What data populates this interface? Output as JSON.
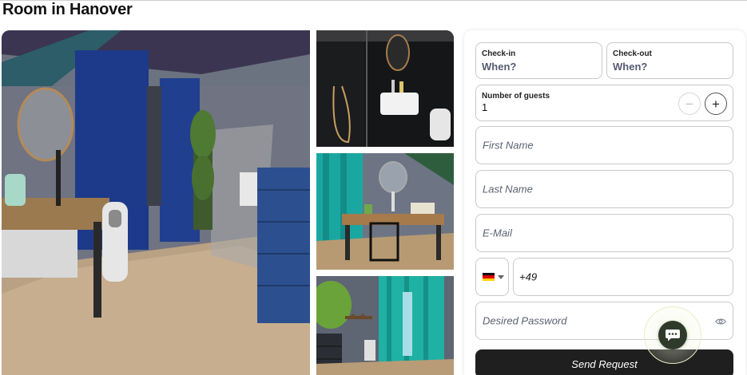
{
  "page": {
    "title": "Room in Hanover"
  },
  "gallery": {
    "photos": [
      {
        "subject": "bedroom-with-blue-curtains"
      },
      {
        "subject": "bathroom-shower-and-sink"
      },
      {
        "subject": "desk-with-teal-curtains"
      },
      {
        "subject": "room-with-teal-curtains-and-drawers"
      }
    ]
  },
  "form": {
    "checkin": {
      "label": "Check-in",
      "value": "When?"
    },
    "checkout": {
      "label": "Check-out",
      "value": "When?"
    },
    "guests": {
      "label": "Number of guests",
      "value": "1",
      "minus": "−",
      "plus": "+"
    },
    "first_name": {
      "placeholder": "First Name"
    },
    "last_name": {
      "placeholder": "Last Name"
    },
    "email": {
      "placeholder": "E-Mail"
    },
    "phone": {
      "country_flag": "germany-flag-icon",
      "value": "+49"
    },
    "password": {
      "placeholder": "Desired Password"
    },
    "submit_label": "Send Request"
  },
  "chat": {
    "icon": "chat-bubble-icon"
  },
  "colors": {
    "button_dark": "#1f1f1f",
    "chat_button": "#2f3a2b",
    "field_border": "#c9c9c9",
    "value_text": "#555c72"
  }
}
